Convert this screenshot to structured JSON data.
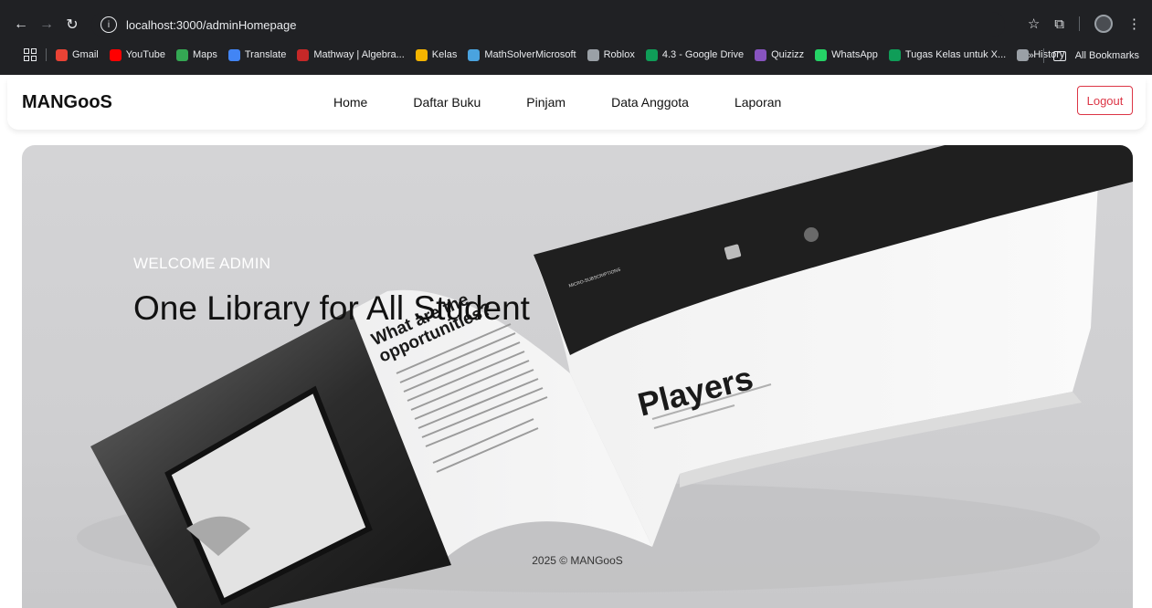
{
  "browser": {
    "url": "localhost:3000/adminHomepage",
    "bookmarks": [
      {
        "label": "Gmail",
        "color": "#ea4335"
      },
      {
        "label": "YouTube",
        "color": "#ff0000"
      },
      {
        "label": "Maps",
        "color": "#34a853"
      },
      {
        "label": "Translate",
        "color": "#4285f4"
      },
      {
        "label": "Mathway | Algebra...",
        "color": "#c62828"
      },
      {
        "label": "Kelas",
        "color": "#f4b400"
      },
      {
        "label": "MathSolverMicrosoft",
        "color": "#4aa3df"
      },
      {
        "label": "Roblox",
        "color": "#9aa0a6"
      },
      {
        "label": "4.3 - Google Drive",
        "color": "#0f9d58"
      },
      {
        "label": "Quizizz",
        "color": "#8854c0"
      },
      {
        "label": "WhatsApp",
        "color": "#25d366"
      },
      {
        "label": "Tugas Kelas untuk X...",
        "color": "#0f9d58"
      },
      {
        "label": "History",
        "color": "#9aa0a6"
      }
    ],
    "more_label": "»",
    "all_bookmarks_label": "All Bookmarks"
  },
  "navbar": {
    "brand": "MANGooS",
    "items": [
      "Home",
      "Daftar Buku",
      "Pinjam",
      "Data Anggota",
      "Laporan"
    ],
    "logout_label": "Logout"
  },
  "hero": {
    "welcome": "WELCOME ADMIN",
    "headline": "One Library for All Student",
    "footer": "2025 © MANGooS",
    "book_texts": {
      "left_heading": "What are the opportunities?",
      "right_heading": "Players",
      "section_label": "MICRO-SUBSCRIPTIONS"
    }
  },
  "colors": {
    "logout": "#dc3545",
    "chrome_bg": "#202124"
  }
}
